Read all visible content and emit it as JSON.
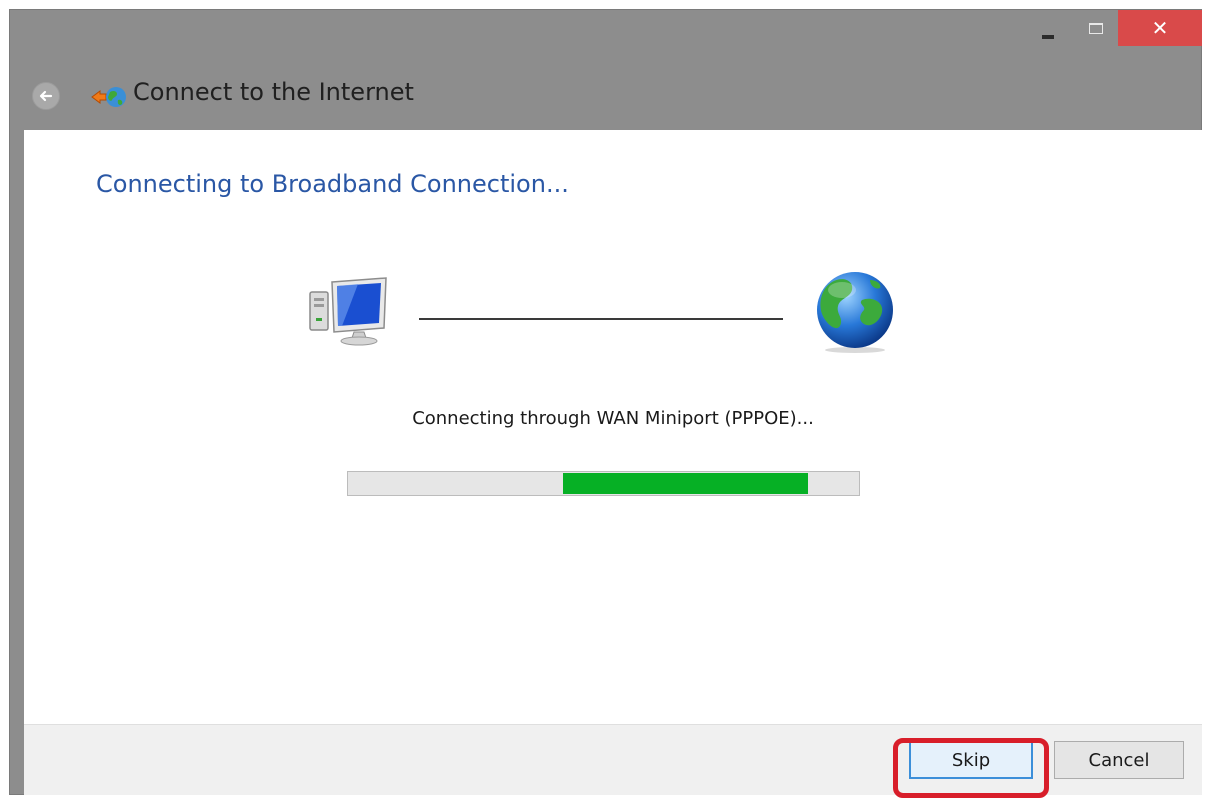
{
  "window": {
    "title": "Connect to the Internet",
    "controls": [
      "minimize-icon",
      "maximize-icon",
      "close-icon"
    ],
    "close_glyph": "✕"
  },
  "nav": {
    "back_icon": "back-arrow-icon",
    "app_icon": "network-globe-icon"
  },
  "content": {
    "heading": "Connecting to Broadband Connection...",
    "source_icon": "computer-icon",
    "destination_icon": "globe-icon",
    "status_text": "Connecting through WAN Miniport (PPPOE)...",
    "progress": {
      "indeterminate": true,
      "fill_start_fraction": 0.42,
      "fill_end_fraction": 0.9,
      "color": "#06b025"
    }
  },
  "footer": {
    "skip_label": "Skip",
    "cancel_label": "Cancel",
    "highlight_color": "#d81e2a"
  },
  "colors": {
    "heading": "#2a57a5",
    "title_bar": "#8d8d8d",
    "close_button": "#d94a4a"
  }
}
